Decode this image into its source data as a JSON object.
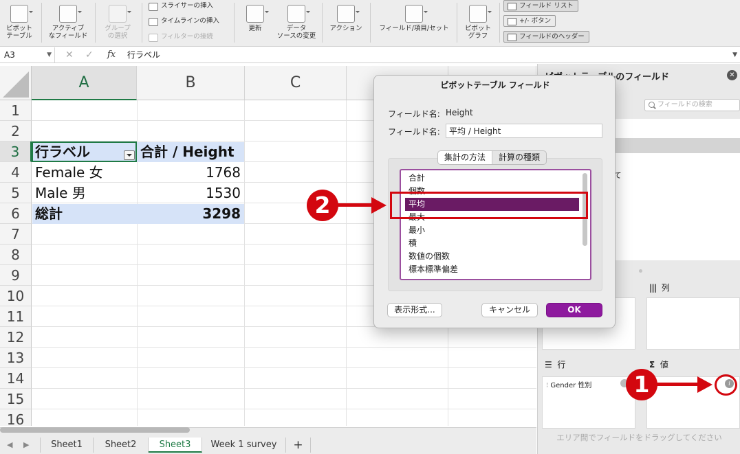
{
  "ribbon": {
    "pivot_table": "ピボット\nテーブル",
    "active_field": "アクティブ\nなフィールド",
    "group_selection": "グループ\nの選択",
    "insert_slicer": "スライサーの挿入",
    "insert_timeline": "タイムラインの挿入",
    "filter_connections": "フィルターの接続",
    "refresh": "更新",
    "change_data_source": "データ\nソースの変更",
    "actions": "アクション",
    "fields_items_sets": "フィールド/項目/セット",
    "pivot_chart": "ピボット\nグラフ",
    "field_list": "フィールド リスト",
    "plus_minus_buttons": "+/- ボタン",
    "field_headers": "フィールドのヘッダー"
  },
  "formula_bar": {
    "name_box": "A3",
    "fx": "fx",
    "cancel_icon": "✕",
    "confirm_icon": "✓",
    "formula": "行ラベル"
  },
  "grid": {
    "columns": [
      "A",
      "B",
      "C"
    ],
    "rows": [
      "1",
      "2",
      "3",
      "4",
      "5",
      "6",
      "7",
      "8",
      "9",
      "10",
      "11",
      "12",
      "13",
      "14",
      "15",
      "16"
    ],
    "cells": {
      "a3": "行ラベル",
      "b3": "合計 / Height",
      "a4": "Female 女",
      "b4": "1768",
      "a5": "Male 男",
      "b5": "1530",
      "a6": "総計",
      "b6": "3298"
    },
    "selected_cell": "A3",
    "header_band_color": "#d6e3f8"
  },
  "sheet_tabs": {
    "tabs": [
      "Sheet1",
      "Sheet2",
      "Sheet3",
      "Week 1 survey"
    ],
    "active": "Sheet3",
    "add": "+"
  },
  "pivot_pane": {
    "title": "ピボットテーブルのフィールド",
    "search_placeholder": "フィールドの検索",
    "list_fragment_1": "゚",
    "list_fragment_2": "いて",
    "columns_label": "列",
    "rows_label": "行",
    "values_label": "値",
    "row_field": "Gender 性別",
    "drag_hint": "エリア間でフィールドをドラッグしてください",
    "info_icon": "i"
  },
  "dialog": {
    "title": "ピボットテーブル フィールド",
    "field_name_label": "フィールド名:",
    "field_name_value": "Height",
    "custom_name_label": "フィールド名:",
    "custom_name_value": "平均 / Height",
    "tab_summarize": "集計の方法",
    "tab_calc": "計算の種類",
    "functions": [
      "合計",
      "個数",
      "平均",
      "最大",
      "最小",
      "積",
      "数値の個数",
      "標本標準偏差"
    ],
    "selected_function": "平均",
    "number_format_button": "表示形式...",
    "cancel_button": "キャンセル",
    "ok_button": "OK",
    "accent_color": "#8e1a9e"
  },
  "annotations": {
    "step1": "1",
    "step2": "2",
    "color": "#d3070f"
  }
}
